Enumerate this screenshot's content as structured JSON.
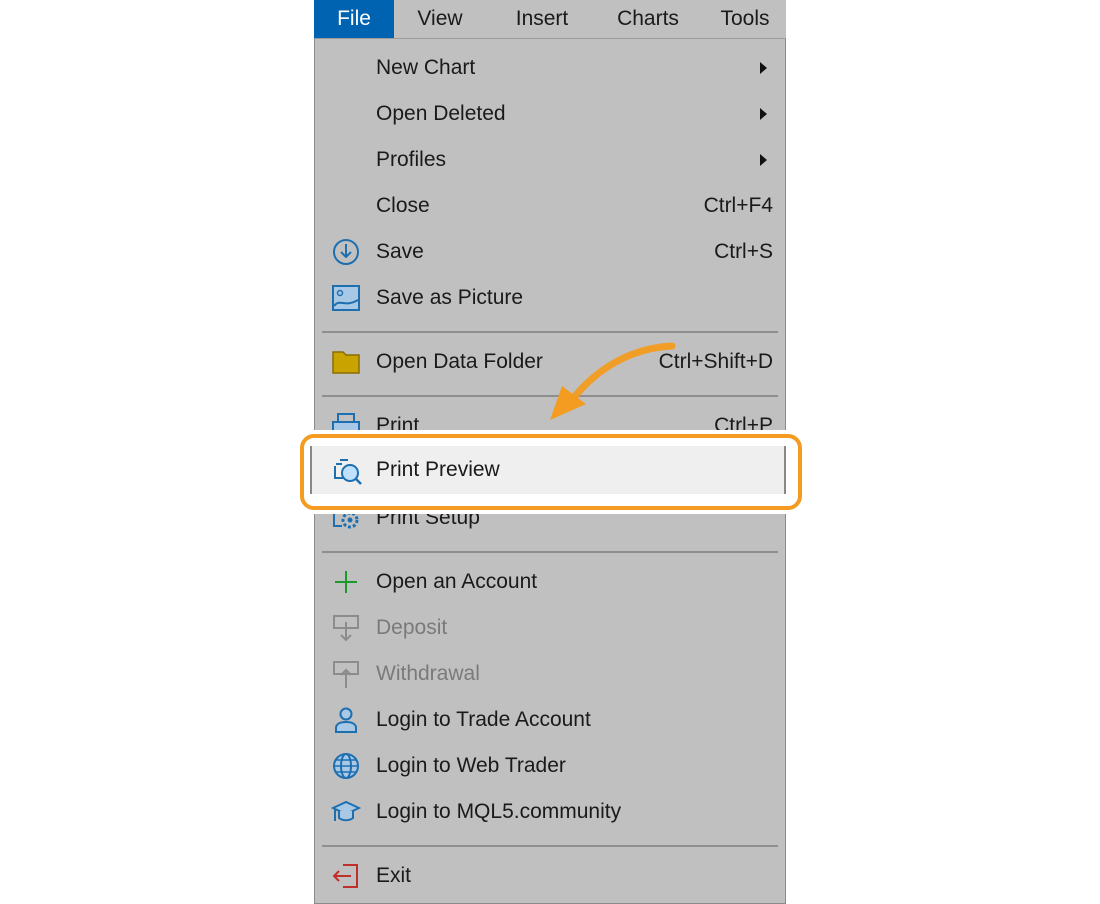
{
  "menubar": {
    "items": [
      {
        "label": "File",
        "active": true
      },
      {
        "label": "View"
      },
      {
        "label": "Insert"
      },
      {
        "label": "Charts"
      },
      {
        "label": "Tools"
      }
    ],
    "active_color": "#0063b1"
  },
  "file_menu": {
    "items": [
      {
        "type": "item",
        "label": "New Chart",
        "submenu": true
      },
      {
        "type": "item",
        "label": "Open Deleted",
        "submenu": true
      },
      {
        "type": "item",
        "label": "Profiles",
        "submenu": true
      },
      {
        "type": "item",
        "label": "Close",
        "shortcut": "Ctrl+F4"
      },
      {
        "type": "item",
        "label": "Save",
        "shortcut": "Ctrl+S",
        "icon": "save-icon"
      },
      {
        "type": "item",
        "label": "Save as Picture",
        "icon": "picture-icon"
      },
      {
        "type": "separator"
      },
      {
        "type": "item",
        "label": "Open Data Folder",
        "shortcut": "Ctrl+Shift+D",
        "icon": "folder-icon"
      },
      {
        "type": "separator"
      },
      {
        "type": "item",
        "label": "Print",
        "shortcut": "Ctrl+P",
        "icon": "printer-icon"
      },
      {
        "type": "item",
        "label": "Print Preview",
        "icon": "print-preview-icon",
        "highlighted": true
      },
      {
        "type": "item",
        "label": "Print Setup",
        "icon": "print-setup-icon"
      },
      {
        "type": "separator"
      },
      {
        "type": "item",
        "label": "Open an Account",
        "icon": "plus-icon"
      },
      {
        "type": "item",
        "label": "Deposit",
        "icon": "deposit-icon",
        "disabled": true
      },
      {
        "type": "item",
        "label": "Withdrawal",
        "icon": "withdrawal-icon",
        "disabled": true
      },
      {
        "type": "item",
        "label": "Login to Trade Account",
        "icon": "user-icon"
      },
      {
        "type": "item",
        "label": "Login to Web Trader",
        "icon": "globe-icon"
      },
      {
        "type": "item",
        "label": "Login to MQL5.community",
        "icon": "graduation-cap-icon"
      },
      {
        "type": "separator"
      },
      {
        "type": "item",
        "label": "Exit",
        "icon": "exit-icon"
      }
    ]
  },
  "annotation": {
    "highlight_color": "#f39c21",
    "arrow_icon": "curved-arrow-icon"
  }
}
